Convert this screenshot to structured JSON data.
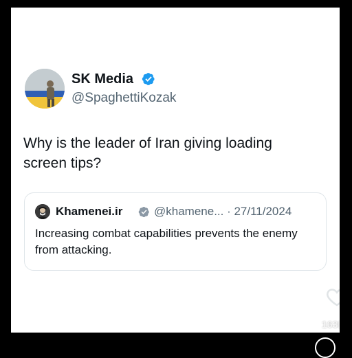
{
  "tweet": {
    "author_name": "SK Media",
    "author_handle": "@SpaghettiKozak",
    "text": "Why is the leader of Iran giving loading screen tips?",
    "verified": true
  },
  "quoted_tweet": {
    "author_name": "Khamenei.ir",
    "handle_and_date": "@khamene... · 27/11/2024",
    "text": "Increasing combat capabilities prevents the enemy from attacking.",
    "verified": true
  },
  "overlay": {
    "like_count": "163K"
  },
  "colors": {
    "verified_blue": "#1d9bf0",
    "text_primary": "#0f1419",
    "text_secondary": "#536471",
    "quote_border": "#dfe5e9",
    "background_frame": "#000000"
  },
  "icons": {
    "verified": "verified-badge-icon",
    "like": "heart-icon"
  }
}
